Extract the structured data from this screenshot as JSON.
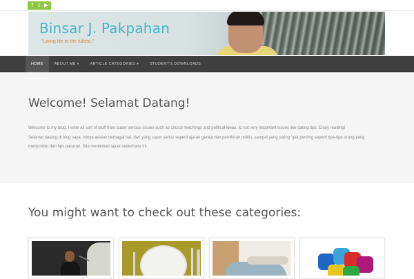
{
  "social": [
    {
      "icon": "facebook-icon",
      "glyph": "f"
    },
    {
      "icon": "twitter-icon",
      "glyph": "t"
    },
    {
      "icon": "youtube-icon",
      "glyph": "▶"
    }
  ],
  "header": {
    "site_title": "Binsar J. Pakpahan",
    "tagline": "\"Living life to the fullest.\""
  },
  "nav": {
    "items": [
      {
        "label": "HOME",
        "has_dropdown": false,
        "active": true
      },
      {
        "label": "ABOUT ME",
        "has_dropdown": true,
        "active": false
      },
      {
        "label": "ARTICLE CATEGORIES",
        "has_dropdown": true,
        "active": false
      },
      {
        "label": "STUDENT'S DOWNLOADS",
        "has_dropdown": false,
        "active": false
      }
    ],
    "dropdown_caret": "▾"
  },
  "welcome": {
    "title": "Welcome! Selamat Datang!",
    "paragraph_en": "Welcome to my blog. I write all sort of stuff from super serious issues such as church teachings and political ideas, to not very important issues like dating tips. Enjoy reading!",
    "paragraph_id": "Selamat datang di blog saya. Isinya adalah berbagai hal, dari yang super serius seperti ajaran gereja dan pemikiran politis, sampai yang paling 'gak penting seperti tipe-tipe orang yang menjomblo dan tips pacaran. Sila menikmati lapak sederhana ini."
  },
  "categories": {
    "title": "You might want to check out these categories:",
    "thumbnails": [
      {
        "name": "category-thumb-speaker"
      },
      {
        "name": "category-thumb-dining"
      },
      {
        "name": "category-thumb-relax"
      },
      {
        "name": "category-thumb-puzzle"
      }
    ]
  },
  "colors": {
    "brand_title": "#45b5c4",
    "tagline": "#d9853b",
    "social_bar": "#8dc63f",
    "navbar": "#3f3f3f",
    "nav_active": "#555555",
    "welcome_bg": "#f5f5f5"
  }
}
